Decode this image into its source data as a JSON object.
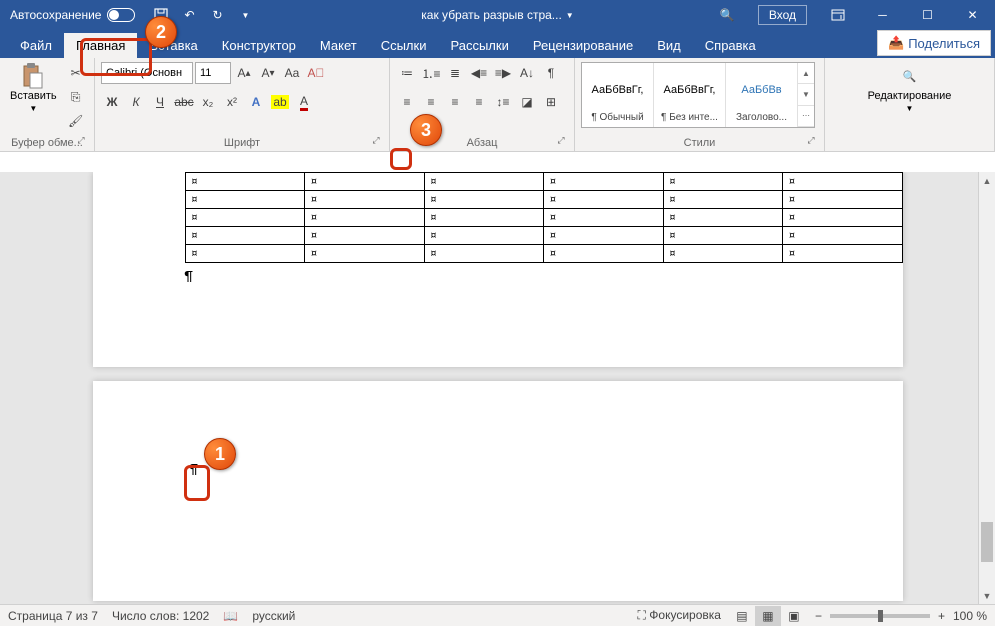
{
  "titlebar": {
    "autosave_label": "Автосохранение",
    "doc_title": "как убрать разрыв стра...",
    "login_label": "Вход"
  },
  "tabs": {
    "file": "Файл",
    "home": "Главная",
    "insert": "Вставка",
    "design": "Конструктор",
    "layout": "Макет",
    "references": "Ссылки",
    "mailings": "Рассылки",
    "review": "Рецензирование",
    "view": "Вид",
    "help": "Справка",
    "share": "Поделиться"
  },
  "ribbon": {
    "clipboard": {
      "paste": "Вставить",
      "label": "Буфер обме..."
    },
    "font": {
      "name": "Calibri (Основн",
      "size": "11",
      "label": "Шрифт",
      "bold": "Ж",
      "italic": "К",
      "underline": "Ч",
      "strike": "abc",
      "sub": "x₂",
      "sup": "x²"
    },
    "paragraph": {
      "label": "Абзац"
    },
    "styles": {
      "label": "Стили",
      "items": [
        {
          "preview": "АаБбВвГг,",
          "name": "¶ Обычный"
        },
        {
          "preview": "АаБбВвГг,",
          "name": "¶ Без инте..."
        },
        {
          "preview": "АаБбВв",
          "name": "Заголово..."
        }
      ]
    },
    "editing": {
      "label": "Редактирование"
    }
  },
  "document": {
    "cell_marker": "¤",
    "pilcrow": "¶"
  },
  "statusbar": {
    "page": "Страница 7 из 7",
    "words": "Число слов: 1202",
    "language": "русский",
    "focus": "Фокусировка",
    "zoom": "100 %"
  },
  "callouts": {
    "c1": "1",
    "c2": "2",
    "c3": "3"
  }
}
